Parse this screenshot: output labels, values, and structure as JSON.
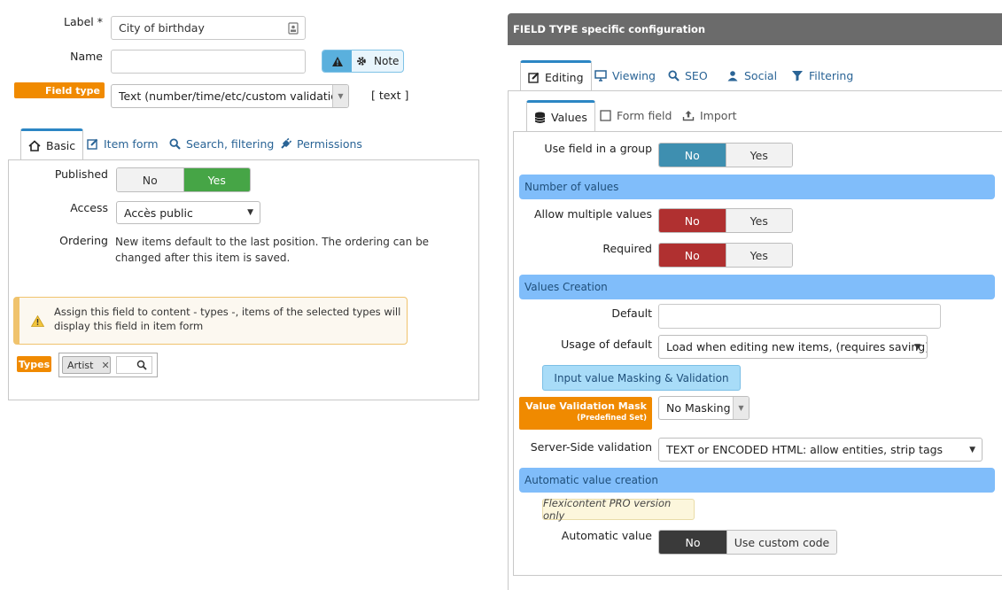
{
  "left": {
    "label_label": "Label *",
    "label_value": "City of birthday",
    "name_label": "Name",
    "name_value": "",
    "note_label": "Note",
    "field_type_badge": "Field type",
    "field_type_value": "Text (number/time/etc/custom validation)",
    "field_type_code": "[ text ]",
    "tabs": [
      {
        "label": "Basic",
        "icon": "home-icon"
      },
      {
        "label": "Item form",
        "icon": "edit-icon"
      },
      {
        "label": "Search, filtering",
        "icon": "search-icon"
      },
      {
        "label": "Permissions",
        "icon": "plug-icon"
      }
    ],
    "published_label": "Published",
    "published_no": "No",
    "published_yes": "Yes",
    "access_label": "Access",
    "access_value": "Accès public",
    "ordering_label": "Ordering",
    "ordering_text_1": "New items default to the last position. The ordering can be",
    "ordering_text_2": "changed after this item is saved.",
    "alert_text_1": "Assign this field to content - types -, items of the selected types will",
    "alert_text_2": "display this field in item form",
    "types_badge": "Types",
    "types_chip": "Artist"
  },
  "right": {
    "header": "FIELD TYPE specific configuration",
    "tabs": [
      {
        "label": "Editing",
        "icon": "edit-icon"
      },
      {
        "label": "Viewing",
        "icon": "monitor-icon"
      },
      {
        "label": "SEO",
        "icon": "search-icon"
      },
      {
        "label": "Social",
        "icon": "users-icon"
      },
      {
        "label": "Filtering",
        "icon": "filter-icon"
      }
    ],
    "subtabs": [
      {
        "label": "Values",
        "icon": "database-icon"
      },
      {
        "label": "Form field",
        "icon": "checkbox-icon"
      },
      {
        "label": "Import",
        "icon": "upload-icon"
      }
    ],
    "use_group_label": "Use field in a group",
    "use_group_no": "No",
    "use_group_yes": "Yes",
    "section_number": "Number of values",
    "allow_multiple_label": "Allow multiple values",
    "allow_multiple_no": "No",
    "allow_multiple_yes": "Yes",
    "required_label": "Required",
    "required_no": "No",
    "required_yes": "Yes",
    "section_values_creation": "Values Creation",
    "default_label": "Default",
    "default_value": "",
    "usage_default_label": "Usage of default",
    "usage_default_value": "Load when editing new items, (requires saving)",
    "masking_button": "Input value Masking & Validation",
    "mask_badge_title": "Value Validation Mask",
    "mask_badge_sub": "(Predefined Set)",
    "mask_value": "No Masking",
    "server_validation_label": "Server-Side validation",
    "server_validation_value": "TEXT or ENCODED HTML: allow entities, strip tags",
    "section_automatic": "Automatic value creation",
    "pro_note": "Flexicontent PRO version only",
    "automatic_label": "Automatic value",
    "automatic_no": "No",
    "automatic_custom": "Use custom code"
  },
  "colors": {
    "accent_blue": "#3e8fb0",
    "success_green": "#46a546",
    "danger_red": "#b03030",
    "badge_orange": "#f08a00",
    "section_blue": "#80bdfa",
    "header_gray": "#6b6b6b"
  }
}
